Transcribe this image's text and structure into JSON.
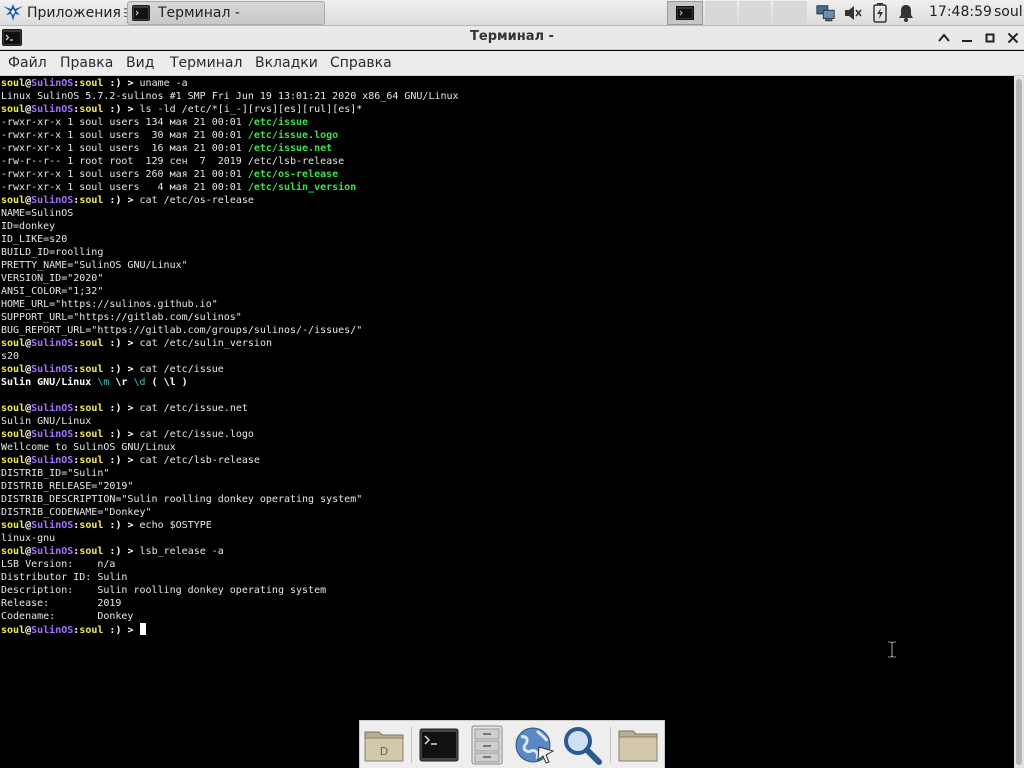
{
  "panel": {
    "apps_label": "Приложения",
    "apps_sep": "☰",
    "task_title": "Терминал -",
    "clock": "17:48:59",
    "user": "soul"
  },
  "window": {
    "title": "Терминал -"
  },
  "menu": [
    "Файл",
    "Правка",
    "Вид",
    "Терминал",
    "Вкладки",
    "Справка"
  ],
  "terminal": {
    "user": "soul",
    "at": "@",
    "host": "SulinOS",
    "colon": ":",
    "dir": "soul",
    "smile": " :) > ",
    "lines": [
      {
        "type": "prompt",
        "cmd": "uname -a"
      },
      {
        "type": "text",
        "text": "Linux SulinOS 5.7.2-sulinos #1 SMP Fri Jun 19 13:01:21 2020 x86_64 GNU/Linux"
      },
      {
        "type": "prompt",
        "cmd": "ls -ld /etc/*[i_-][rvs][es][rul][es]*"
      },
      {
        "type": "ls",
        "meta": "-rwxr-xr-x 1 soul users 134 мая 21 00:01 ",
        "name": "/etc/issue",
        "color": "g"
      },
      {
        "type": "ls",
        "meta": "-rwxr-xr-x 1 soul users  30 мая 21 00:01 ",
        "name": "/etc/issue.logo",
        "color": "g"
      },
      {
        "type": "ls",
        "meta": "-rwxr-xr-x 1 soul users  16 мая 21 00:01 ",
        "name": "/etc/issue.net",
        "color": "g"
      },
      {
        "type": "ls",
        "meta": "-rw-r--r-- 1 root root  129 сен  7  2019 ",
        "name": "/etc/lsb-release",
        "color": ""
      },
      {
        "type": "ls",
        "meta": "-rwxr-xr-x 1 soul users 260 мая 21 00:01 ",
        "name": "/etc/os-release",
        "color": "g"
      },
      {
        "type": "ls",
        "meta": "-rwxr-xr-x 1 soul users   4 мая 21 00:01 ",
        "name": "/etc/sulin_version",
        "color": "g"
      },
      {
        "type": "prompt",
        "cmd": "cat /etc/os-release"
      },
      {
        "type": "text",
        "text": "NAME=SulinOS"
      },
      {
        "type": "text",
        "text": "ID=donkey"
      },
      {
        "type": "text",
        "text": "ID_LIKE=s20"
      },
      {
        "type": "text",
        "text": "BUILD_ID=roolling"
      },
      {
        "type": "text",
        "text": "PRETTY_NAME=\"SulinOS GNU/Linux\""
      },
      {
        "type": "text",
        "text": "VERSION_ID=\"2020\""
      },
      {
        "type": "text",
        "text": "ANSI_COLOR=\"1;32\""
      },
      {
        "type": "text",
        "text": "HOME_URL=\"https://sulinos.github.io\""
      },
      {
        "type": "text",
        "text": "SUPPORT_URL=\"https://gitlab.com/sulinos\""
      },
      {
        "type": "text",
        "text": "BUG_REPORT_URL=\"https://gitlab.com/groups/sulinos/-/issues/\""
      },
      {
        "type": "prompt",
        "cmd": "cat /etc/sulin_version"
      },
      {
        "type": "text",
        "text": "s20"
      },
      {
        "type": "prompt",
        "cmd": "cat /etc/issue"
      },
      {
        "type": "issue",
        "a": "Sulin GNU/Linux ",
        "b": "\\m",
        "c": " \\r ",
        "d": "\\d",
        "e": " ( \\l )"
      },
      {
        "type": "blank"
      },
      {
        "type": "prompt",
        "cmd": "cat /etc/issue.net"
      },
      {
        "type": "text",
        "text": "Sulin GNU/Linux"
      },
      {
        "type": "prompt",
        "cmd": "cat /etc/issue.logo"
      },
      {
        "type": "text",
        "text": "Wellcome to SulinOS GNU/Linux"
      },
      {
        "type": "prompt",
        "cmd": "cat /etc/lsb-release"
      },
      {
        "type": "text",
        "text": "DISTRIB_ID=\"Sulin\""
      },
      {
        "type": "text",
        "text": "DISTRIB_RELEASE=\"2019\""
      },
      {
        "type": "text",
        "text": "DISTRIB_DESCRIPTION=\"Sulin roolling donkey operating system\""
      },
      {
        "type": "text",
        "text": "DISTRIB_CODENAME=\"Donkey\""
      },
      {
        "type": "prompt",
        "cmd": "echo $OSTYPE"
      },
      {
        "type": "text",
        "text": "linux-gnu"
      },
      {
        "type": "prompt",
        "cmd": "lsb_release -a"
      },
      {
        "type": "text",
        "text": "LSB Version:    n/a"
      },
      {
        "type": "text",
        "text": "Distributor ID: Sulin"
      },
      {
        "type": "text",
        "text": "Description:    Sulin roolling donkey operating system"
      },
      {
        "type": "text",
        "text": "Release:        2019"
      },
      {
        "type": "text",
        "text": "Codename:       Donkey"
      },
      {
        "type": "prompt",
        "cmd": "",
        "cursor": true
      }
    ]
  },
  "dock": [
    {
      "name": "home-folder-icon"
    },
    {
      "name": "terminal-icon"
    },
    {
      "name": "file-cabinet-icon"
    },
    {
      "name": "web-browser-icon"
    },
    {
      "name": "search-icon"
    },
    {
      "name": "folder-icon"
    }
  ],
  "colors": {
    "prompt_user": "#f4eb4f",
    "prompt_host": "#a772ff",
    "exec_file": "#3ee04a",
    "escape": "#3bbfbf"
  }
}
